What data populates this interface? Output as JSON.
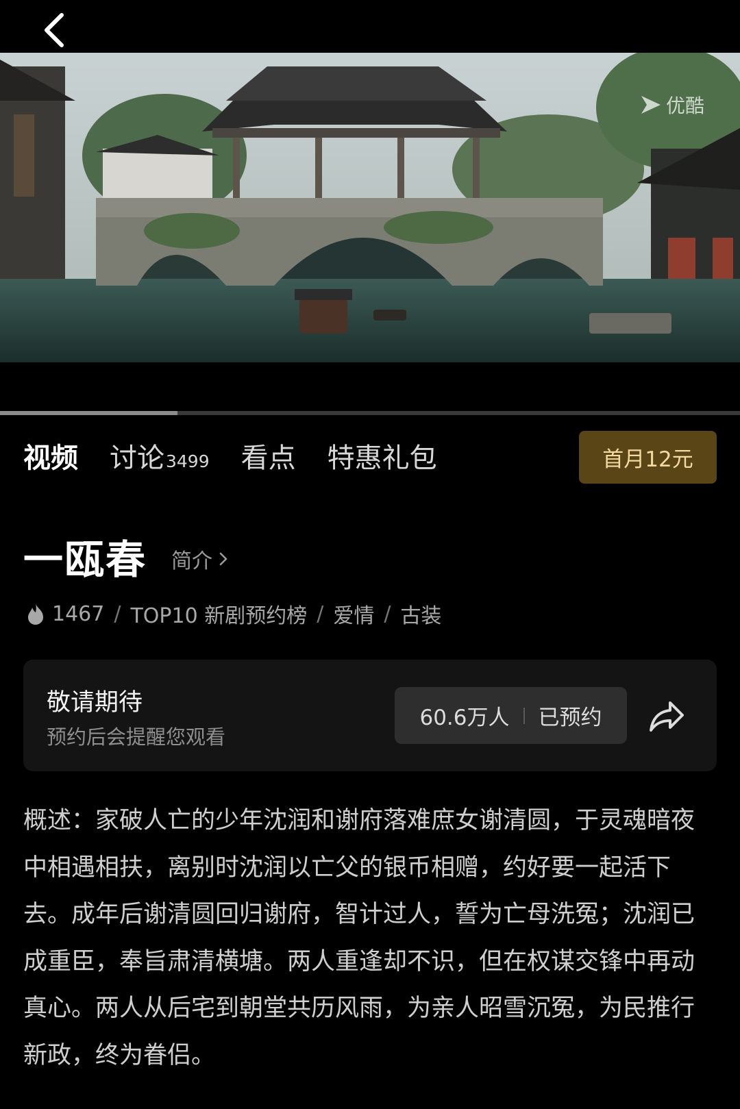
{
  "header": {
    "back_icon": "chevron-left-icon"
  },
  "video": {
    "watermark_icon": "youku-play-icon",
    "watermark_text": "优酷",
    "progress_fraction": 0.24
  },
  "tabs": [
    {
      "label": "视频",
      "active": true
    },
    {
      "label": "讨论",
      "count": "3499"
    },
    {
      "label": "看点"
    },
    {
      "label": "特惠礼包"
    }
  ],
  "promo": {
    "label": "首月12元",
    "bg_color": "#5a4516",
    "text_color": "#f4d9a0"
  },
  "show": {
    "title": "一瓯春",
    "intro_link": "简介",
    "intro_icon": "chevron-right-icon"
  },
  "meta": {
    "heat_icon": "flame-icon",
    "heat": "1467",
    "rank": "TOP10 新剧预约榜",
    "genre1": "爱情",
    "genre2": "古装",
    "separator": "/"
  },
  "reservation": {
    "title": "敬请期待",
    "subtitle": "预约后会提醒您观看",
    "count": "60.6万人",
    "status": "已预约",
    "share_icon": "share-arrow-icon"
  },
  "summary": "概述：家破人亡的少年沈润和谢府落难庶女谢清圆，于灵魂暗夜中相遇相扶，离别时沈润以亡父的银币相赠，约好要一起活下去。成年后谢清圆回归谢府，智计过人，誓为亡母洗冤；沈润已成重臣，奉旨肃清横塘。两人重逢却不识，但在权谋交锋中再动真心。两人从后宅到朝堂共历风雨，为亲人昭雪沉冤，为民推行新政，终为眷侣。"
}
